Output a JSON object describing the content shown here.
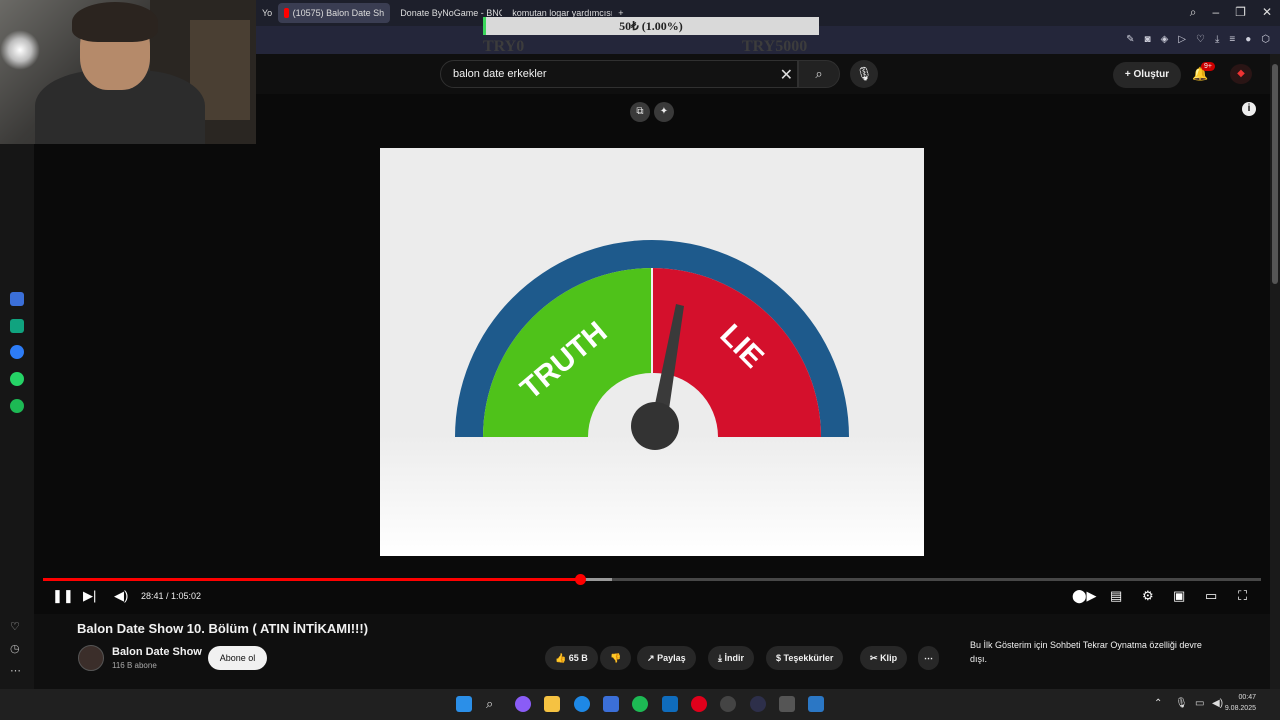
{
  "browser": {
    "tabs": [
      {
        "label": "Yo",
        "active": false,
        "favicon_color": "#ffffff"
      },
      {
        "label": "(10575) Balon Date Sh",
        "active": true,
        "favicon_color": "#ff0000"
      },
      {
        "label": "Donate ByNoGame - BNG",
        "active": false,
        "favicon_color": "#f5b400"
      },
      {
        "label": "komutan logar yardımcısı",
        "active": false,
        "favicon_color": "#ffffff"
      }
    ],
    "new_tab_icon": "plus-icon"
  },
  "donation": {
    "progress_text": "50₺ (1.00%)",
    "progress_percent": 1,
    "min_label": "TRY0",
    "max_label": "TRY5000",
    "fill_color": "#3ad65a"
  },
  "youtube": {
    "search_query": "balon date erkekler",
    "create_label": "Oluştur",
    "notification_count": "9+",
    "player": {
      "current_time": "28:41",
      "duration": "1:05:02",
      "time_text": "28:41 / 1:05:02",
      "played_fraction": 0.441,
      "buffered_fraction": 0.467,
      "accent_color": "#ff0000"
    },
    "video": {
      "title": "Balon Date Show 10. Bölüm ( ATIN İNTİKAMI!!!)",
      "channel_name": "Balon Date Show",
      "subscribers": "116 B abone",
      "subscribe_label": "Abone ol",
      "likes": "65 B",
      "share_label": "Paylaş",
      "download_label": "İndir",
      "thanks_label": "Teşekkürler",
      "clip_label": "Klip",
      "live_note": "Bu İlk Gösterim için Sohbeti Tekrar Oynatma özelliği devre dışı."
    },
    "meter": {
      "left_label": "TRUTH",
      "right_label": "LIE",
      "left_color": "#4fc21a",
      "right_color": "#d4102c",
      "rim_color": "#1e5a8c"
    }
  },
  "taskbar": {
    "clock_time": "00:47",
    "clock_date": "9.08.2025"
  }
}
